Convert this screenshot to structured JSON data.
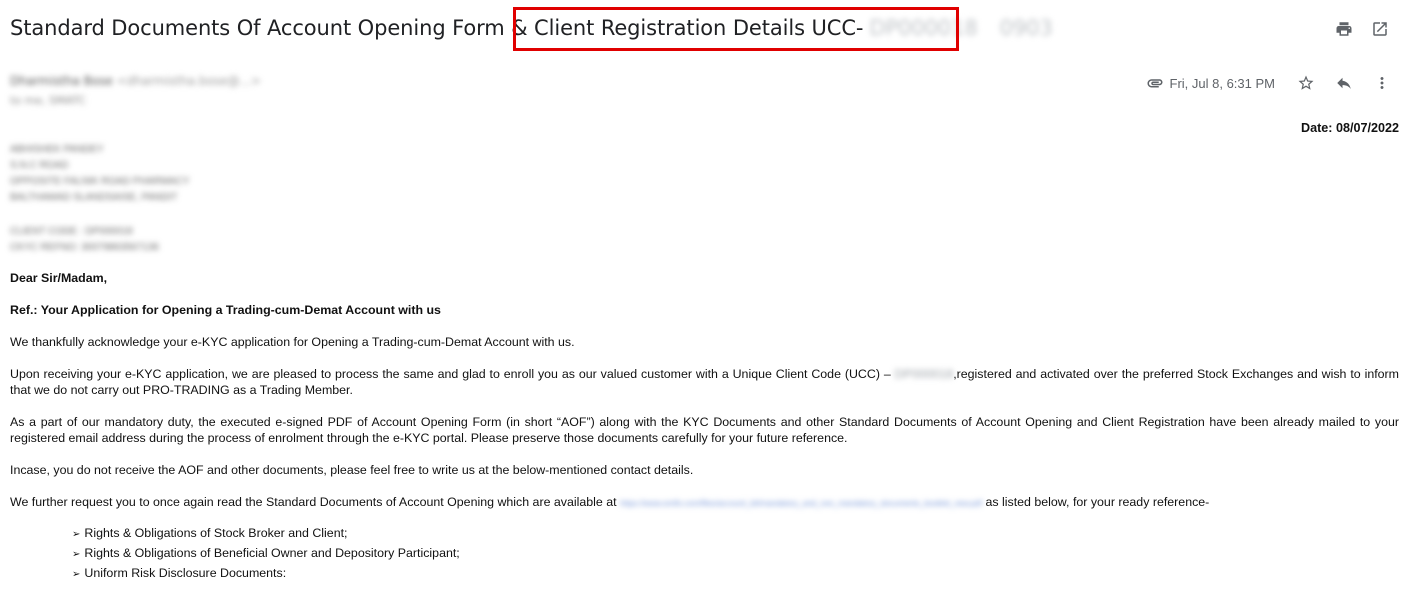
{
  "subject": {
    "visible": "Standard Documents Of Account Opening Form & Client Registration Details UCC-",
    "redacted_ucc": "DP000018",
    "redacted_suffix": "0903"
  },
  "sender": {
    "name": "Dharmistha Bose",
    "email": "<dharmistha.bose@...>",
    "to": "to me, SMATC"
  },
  "meta": {
    "date": "Fri, Jul 8, 6:31 PM"
  },
  "icons": {
    "print": "print-icon",
    "open": "open-in-new-icon",
    "attachment": "attachment-icon",
    "star": "star-icon",
    "reply": "reply-icon",
    "more": "more-vert-icon"
  },
  "body": {
    "date_line": "Date: 08/07/2022",
    "address_lines": [
      "ABHISHEK PANDEY",
      "S.N.C ROAD",
      "OPPOSITE FALNIK ROAD PHARMACY",
      "BALTHAMAD SLANDSAISE, PANDIT"
    ],
    "client_lines": [
      "CLIENT CODE : DP000018",
      "CKYC REFNO: 30079863567136"
    ],
    "salutation": "Dear Sir/Madam,",
    "ref": "Ref.: Your Application for Opening a Trading-cum-Demat Account with us",
    "p1": "We thankfully acknowledge your e-KYC application for Opening a Trading-cum-Demat Account with us.",
    "p2_before": "Upon receiving your e-KYC application, we are pleased to process the same and glad to enroll you as our valued customer with a Unique Client Code (UCC) – ",
    "p2_code": "DP000018",
    "p2_after": ",registered and activated over the preferred Stock Exchanges and wish to inform that we do not carry out PRO-TRADING as a Trading Member.",
    "p3": "As a part of our mandatory duty, the executed e-signed PDF of Account Opening Form (in short “AOF”) along with the KYC Documents and other Standard Documents of Account Opening and Client Registration have been already mailed to your registered email address during the process of enrolment through the e-KYC portal. Please preserve those documents carefully for your future reference.",
    "p4": "Incase, you do not receive the AOF and other documents, please feel free to write us at the below-mentioned contact details.",
    "p5_before": "We further request you to once again read the Standard Documents of Account Opening which are available  at ",
    "p5_link": "https://www.smifs.com/files/account_kit/mandatory_and_non_mandatory_documents_booklet_new.pdf",
    "p5_after": " as listed below, for your ready reference-",
    "list": [
      "Rights & Obligations of Stock Broker and Client;",
      "Rights & Obligations of Beneficial Owner and Depository Participant;",
      "Uniform Risk Disclosure Documents:"
    ]
  }
}
